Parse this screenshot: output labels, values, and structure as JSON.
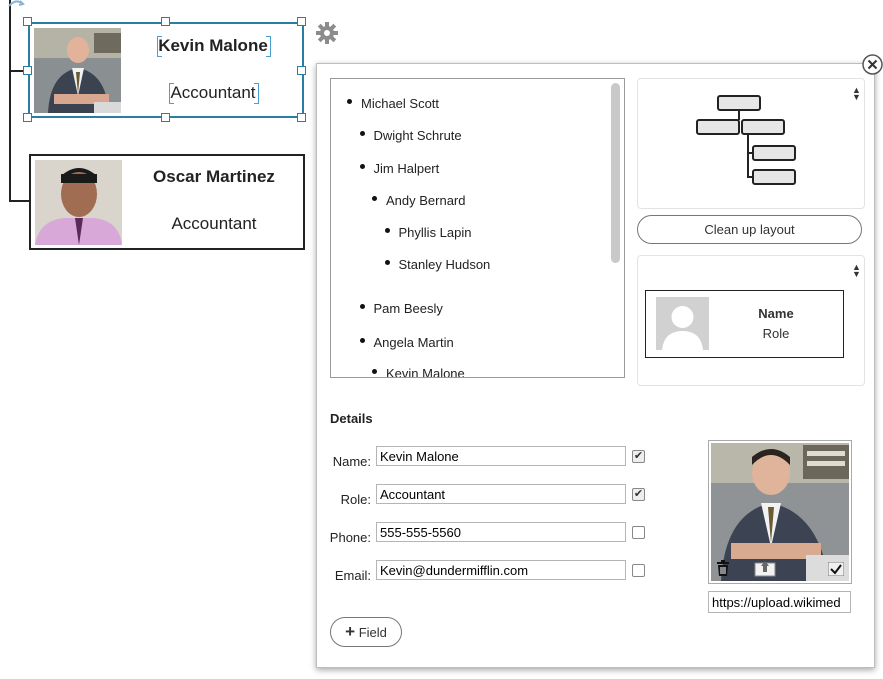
{
  "org_nodes": [
    {
      "name": "Kevin Malone",
      "role": "Accountant",
      "selected": true
    },
    {
      "name": "Oscar Martinez",
      "role": "Accountant",
      "selected": false
    }
  ],
  "colors": {
    "selection": "#2a7ea3",
    "node_border": "#222222"
  },
  "icons": {
    "settings": "gear-icon",
    "close": "close-icon",
    "delete": "trash-icon",
    "upload": "upload-icon",
    "confirm": "checkmark-icon",
    "layout": "hierarchy-icon",
    "placeholder": "avatar-placeholder-icon"
  },
  "tree": {
    "items": [
      {
        "label": "Michael Scott",
        "level": 0
      },
      {
        "label": "Dwight Schrute",
        "level": 1
      },
      {
        "label": "Jim Halpert",
        "level": 1
      },
      {
        "label": "Andy Bernard",
        "level": 2
      },
      {
        "label": "Phyllis Lapin",
        "level": 3
      },
      {
        "label": "Stanley Hudson",
        "level": 3
      },
      {
        "label": "Pam Beesly",
        "level": 1
      },
      {
        "label": "Angela Martin",
        "level": 1
      },
      {
        "label": "Kevin Malone",
        "level": 2
      }
    ]
  },
  "layout_panel": {
    "cleanup_label": "Clean up layout"
  },
  "template_card": {
    "name": "Name",
    "role": "Role"
  },
  "details": {
    "title": "Details",
    "fields": [
      {
        "label": "Name:",
        "value": "Kevin Malone",
        "checked": true
      },
      {
        "label": "Role:",
        "value": "Accountant",
        "checked": true
      },
      {
        "label": "Phone:",
        "value": "555-555-5560",
        "checked": false
      },
      {
        "label": "Email:",
        "value": "Kevin@dundermifflin.com",
        "checked": false
      }
    ],
    "photo_url": "https://upload.wikimed",
    "add_field_label": "Field"
  }
}
